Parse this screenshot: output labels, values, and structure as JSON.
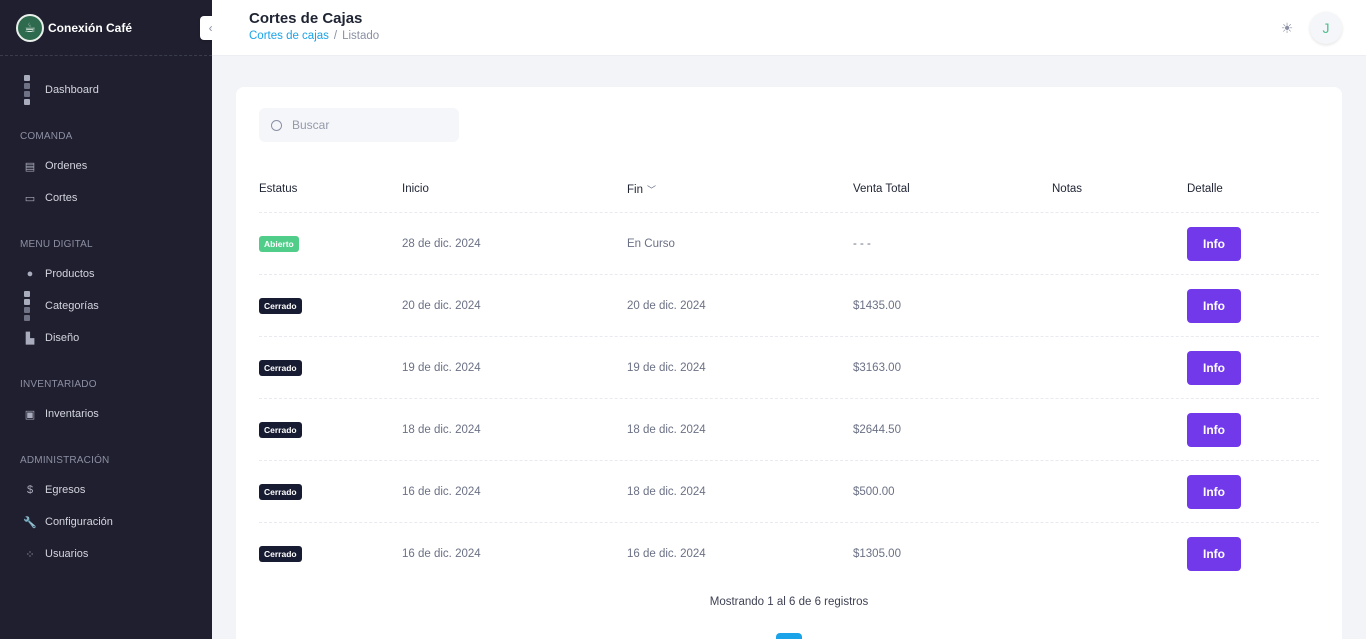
{
  "brand": {
    "name": "Conexión Café"
  },
  "sidebar": {
    "items": [
      {
        "label": "Dashboard",
        "icon": "dashboard-icon"
      },
      {
        "section": "COMANDA"
      },
      {
        "label": "Ordenes",
        "icon": "orders-icon"
      },
      {
        "label": "Cortes",
        "icon": "cuts-icon"
      },
      {
        "section": "MENU DIGITAL"
      },
      {
        "label": "Productos",
        "icon": "products-icon"
      },
      {
        "label": "Categorías",
        "icon": "categories-icon"
      },
      {
        "label": "Diseño",
        "icon": "design-icon"
      },
      {
        "section": "INVENTARIADO"
      },
      {
        "label": "Inventarios",
        "icon": "inventory-icon"
      },
      {
        "section": "ADMINISTRACIÓN"
      },
      {
        "label": "Egresos",
        "icon": "dollar-icon"
      },
      {
        "label": "Configuración",
        "icon": "wrench-icon"
      },
      {
        "label": "Usuarios",
        "icon": "users-icon"
      }
    ]
  },
  "header": {
    "title": "Cortes de Cajas",
    "breadcrumb": {
      "link": "Cortes de cajas",
      "separator": "/",
      "current": "Listado"
    },
    "avatar_initial": "J"
  },
  "search": {
    "placeholder": "Buscar"
  },
  "table": {
    "columns": [
      "Estatus",
      "Inicio",
      "Fin",
      "Venta Total",
      "Notas",
      "Detalle"
    ],
    "rows": [
      {
        "status": "Abierto",
        "status_type": "open",
        "start": "28 de dic. 2024",
        "end": "En Curso",
        "total": "- - -",
        "notes": "",
        "action": "Info"
      },
      {
        "status": "Cerrado",
        "status_type": "closed",
        "start": "20 de dic. 2024",
        "end": "20 de dic. 2024",
        "total": "$1435.00",
        "notes": "",
        "action": "Info"
      },
      {
        "status": "Cerrado",
        "status_type": "closed",
        "start": "19 de dic. 2024",
        "end": "19 de dic. 2024",
        "total": "$3163.00",
        "notes": "",
        "action": "Info"
      },
      {
        "status": "Cerrado",
        "status_type": "closed",
        "start": "18 de dic. 2024",
        "end": "18 de dic. 2024",
        "total": "$2644.50",
        "notes": "",
        "action": "Info"
      },
      {
        "status": "Cerrado",
        "status_type": "closed",
        "start": "16 de dic. 2024",
        "end": "18 de dic. 2024",
        "total": "$500.00",
        "notes": "",
        "action": "Info"
      },
      {
        "status": "Cerrado",
        "status_type": "closed",
        "start": "16 de dic. 2024",
        "end": "16 de dic. 2024",
        "total": "$1305.00",
        "notes": "",
        "action": "Info"
      }
    ]
  },
  "pagination": {
    "summary": "Mostrando 1 al 6 de 6 registros"
  },
  "colors": {
    "sidebar": "#1f1f2f",
    "primary": "#7239ea",
    "link": "#1aa3e8",
    "open": "#50cd89",
    "closed": "#181c32"
  }
}
